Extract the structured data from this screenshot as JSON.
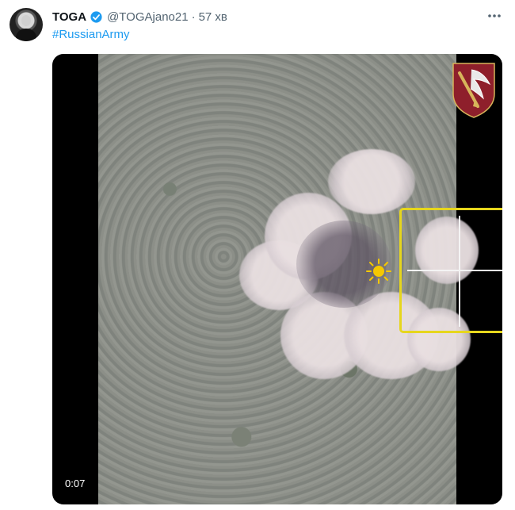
{
  "tweet": {
    "author_name": "TOGA",
    "handle": "@TOGAjano21",
    "separator": "·",
    "time": "57 хв",
    "hashtag": "#RussianArmy"
  },
  "video": {
    "duration": "0:07"
  },
  "icons": {
    "verified": "verified-badge-icon",
    "more": "more-options-icon",
    "insignia": "unit-insignia-icon",
    "target": "target-marker-icon"
  },
  "colors": {
    "accent": "#1d9bf0",
    "reticle": "#e6d61d",
    "marker": "#f5c800"
  }
}
